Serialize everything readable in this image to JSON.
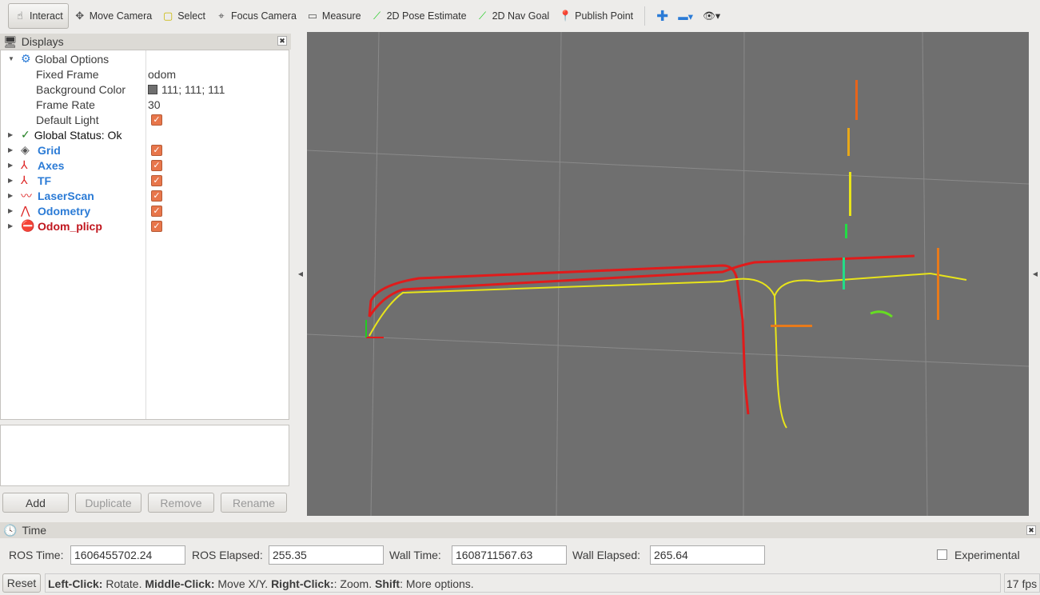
{
  "toolbar": [
    {
      "label": "Interact",
      "icon": "hand-icon",
      "active": true
    },
    {
      "label": "Move Camera",
      "icon": "move-camera-icon"
    },
    {
      "label": "Select",
      "icon": "select-icon"
    },
    {
      "label": "Focus Camera",
      "icon": "focus-camera-icon"
    },
    {
      "label": "Measure",
      "icon": "ruler-icon"
    },
    {
      "label": "2D Pose Estimate",
      "icon": "green-arrow-icon"
    },
    {
      "label": "2D Nav Goal",
      "icon": "green-arrow-icon"
    },
    {
      "label": "Publish Point",
      "icon": "map-pin-icon"
    }
  ],
  "displays": {
    "title": "Displays",
    "global_options": "Global Options",
    "props": [
      {
        "label": "Fixed Frame",
        "value": "odom"
      },
      {
        "label": "Background Color",
        "value": "111; 111; 111",
        "swatch": "#6f6f6f"
      },
      {
        "label": "Frame Rate",
        "value": "30"
      },
      {
        "label": "Default Light",
        "checked": true
      }
    ],
    "status": "Global Status: Ok",
    "items": [
      {
        "label": "Grid",
        "icon": "grid-icon",
        "checked": true,
        "color": "blue"
      },
      {
        "label": "Axes",
        "icon": "axes-icon",
        "checked": true,
        "color": "blue"
      },
      {
        "label": "TF",
        "icon": "tf-icon",
        "checked": true,
        "color": "blue"
      },
      {
        "label": "LaserScan",
        "icon": "laserscan-icon",
        "checked": true,
        "color": "blue"
      },
      {
        "label": "Odometry",
        "icon": "odometry-icon",
        "checked": true,
        "color": "blue"
      },
      {
        "label": "Odom_plicp",
        "icon": "error-icon",
        "checked": true,
        "color": "red"
      }
    ],
    "buttons": {
      "add": "Add",
      "duplicate": "Duplicate",
      "remove": "Remove",
      "rename": "Rename"
    }
  },
  "time": {
    "title": "Time",
    "ros_time_label": "ROS Time:",
    "ros_time": "1606455702.24",
    "ros_elapsed_label": "ROS Elapsed:",
    "ros_elapsed": "255.35",
    "wall_time_label": "Wall Time:",
    "wall_time": "1608711567.63",
    "wall_elapsed_label": "Wall Elapsed:",
    "wall_elapsed": "265.64",
    "experimental": "Experimental"
  },
  "status": {
    "reset": "Reset",
    "k1": "Left-Click:",
    "v1": " Rotate. ",
    "k2": "Middle-Click:",
    "v2": " Move X/Y. ",
    "k3": "Right-Click:",
    "v3": ": Zoom. ",
    "k4": "Shift",
    "v4": ": More options.",
    "fps": "17 fps"
  },
  "colors": {
    "background": "#6f6f6f",
    "odom_path": "#e01b1b",
    "plicp_path": "#e8e41a"
  }
}
